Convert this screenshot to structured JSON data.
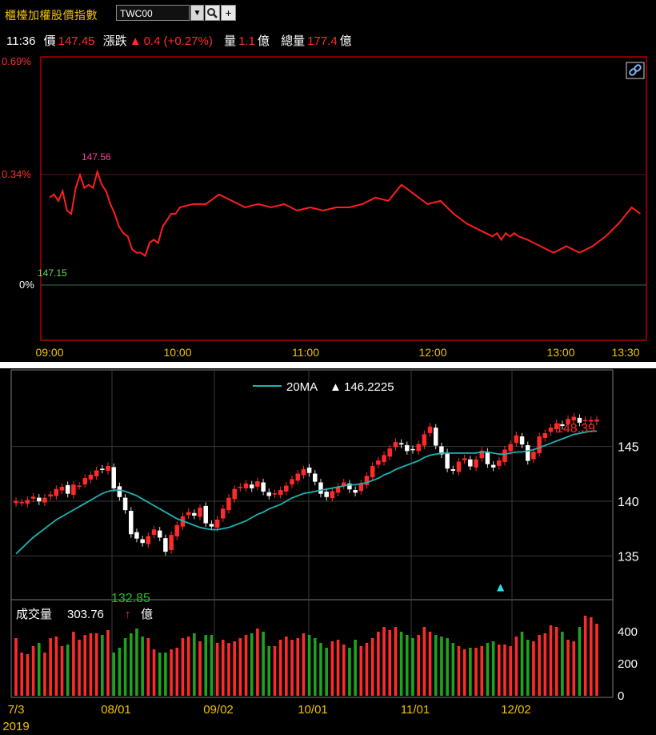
{
  "header": {
    "index_name": "櫃檯加權股價指數",
    "code": "TWC00",
    "dropdown_glyph": "▼",
    "search_icon": "search-icon",
    "add_glyph": "+"
  },
  "quote": {
    "time": "11:36",
    "price_label": "價",
    "price": "147.45",
    "change_label": "漲跌",
    "change_arrow": "▲",
    "change": "0.4 (+0.27%)",
    "vol_label": "量",
    "vol": "1.1",
    "vol_unit": "億",
    "total_label": "總量",
    "total": "177.4",
    "total_unit": "億"
  },
  "colors": {
    "up": "#ff2b2b",
    "down": "#1fa31f",
    "ma": "#20b2b2",
    "label_high": "#ff3ca0",
    "label_low": "#5fdc5f",
    "tick_gold": "#f0c000",
    "border_red": "#b00000"
  },
  "chart_data": [
    {
      "type": "line",
      "name": "intraday",
      "y_tick_labels": [
        "0.69%",
        "0.34%",
        "0%"
      ],
      "ylim_percent": [
        -0.46,
        0.69
      ],
      "x_tick_labels": [
        "09:00",
        "10:00",
        "11:00",
        "12:00",
        "13:00",
        "13:30"
      ],
      "x_range_minutes": [
        0,
        270
      ],
      "high_label": "147.56",
      "ref_label": "147.15",
      "series_minutes": [
        0,
        2,
        4,
        6,
        8,
        10,
        12,
        14,
        16,
        18,
        20,
        22,
        24,
        26,
        28,
        30,
        32,
        34,
        36,
        38,
        40,
        42,
        44,
        46,
        48,
        50,
        52,
        54,
        56,
        58,
        60,
        66,
        72,
        78,
        84,
        90,
        96,
        102,
        108,
        114,
        120,
        126,
        132,
        138,
        144,
        150,
        156,
        162,
        168,
        174,
        180,
        186,
        192,
        198,
        204,
        206,
        208,
        210,
        212,
        214,
        216,
        220,
        226,
        232,
        238,
        244,
        250,
        256,
        262,
        268,
        272
      ],
      "series_percent": [
        0.27,
        0.28,
        0.26,
        0.29,
        0.23,
        0.22,
        0.3,
        0.34,
        0.3,
        0.31,
        0.3,
        0.35,
        0.31,
        0.29,
        0.25,
        0.22,
        0.18,
        0.16,
        0.15,
        0.11,
        0.1,
        0.1,
        0.09,
        0.13,
        0.14,
        0.13,
        0.18,
        0.2,
        0.22,
        0.22,
        0.24,
        0.25,
        0.25,
        0.28,
        0.26,
        0.24,
        0.25,
        0.24,
        0.25,
        0.23,
        0.24,
        0.23,
        0.24,
        0.24,
        0.25,
        0.27,
        0.26,
        0.31,
        0.28,
        0.25,
        0.26,
        0.22,
        0.19,
        0.17,
        0.15,
        0.16,
        0.14,
        0.16,
        0.15,
        0.16,
        0.15,
        0.14,
        0.12,
        0.1,
        0.12,
        0.1,
        0.12,
        0.15,
        0.19,
        0.24,
        0.22
      ]
    },
    {
      "type": "candlestick",
      "name": "daily",
      "legend_label": "20MA",
      "legend_arrow": "▲",
      "legend_value": "146.2225",
      "price_ticks": [
        "145",
        "140",
        "135"
      ],
      "ylim": [
        131,
        152
      ],
      "high_label": "148.39",
      "low_label": "132.85",
      "volume_label": "成交量",
      "volume_value": "303.76",
      "volume_arrow": "↑",
      "volume_unit": "億",
      "volume_ticks": [
        "400",
        "200",
        "0"
      ],
      "volume_ylim": [
        0,
        600
      ],
      "x_tick_labels": [
        "7/3",
        "08/01",
        "09/02",
        "10/01",
        "11/01",
        "12/02"
      ],
      "year_label": "2019",
      "closes": [
        140.0,
        139.9,
        140.1,
        140.4,
        140.0,
        140.3,
        140.6,
        141.1,
        141.3,
        140.7,
        141.5,
        141.4,
        142.1,
        142.4,
        142.8,
        142.9,
        143.2,
        141.2,
        140.4,
        139.2,
        137.0,
        136.6,
        136.2,
        136.8,
        137.4,
        136.7,
        135.4,
        136.9,
        137.8,
        138.6,
        139.0,
        138.7,
        139.4,
        138.0,
        137.7,
        138.3,
        139.3,
        140.3,
        141.1,
        141.3,
        141.6,
        141.2,
        141.8,
        140.9,
        140.5,
        140.7,
        141.0,
        141.4,
        142.0,
        142.5,
        142.9,
        142.6,
        141.8,
        140.7,
        140.4,
        140.9,
        141.3,
        141.7,
        141.1,
        140.8,
        141.6,
        142.3,
        143.2,
        143.7,
        144.2,
        144.8,
        145.4,
        145.2,
        144.6,
        144.7,
        145.2,
        146.1,
        146.8,
        145.1,
        144.3,
        143.0,
        142.8,
        143.6,
        143.9,
        143.2,
        143.8,
        144.6,
        143.4,
        143.1,
        143.7,
        144.7,
        145.2,
        146.0,
        145.2,
        143.7,
        144.5,
        145.9,
        146.2,
        146.7,
        147.1,
        146.9,
        147.5,
        147.7,
        147.2,
        147.4,
        147.4,
        147.45
      ],
      "volumes": [
        360,
        270,
        260,
        310,
        330,
        270,
        360,
        370,
        310,
        320,
        400,
        350,
        380,
        390,
        390,
        380,
        410,
        270,
        300,
        360,
        390,
        420,
        370,
        360,
        290,
        270,
        270,
        290,
        300,
        360,
        370,
        390,
        340,
        380,
        380,
        330,
        350,
        330,
        340,
        360,
        380,
        390,
        420,
        400,
        310,
        310,
        350,
        370,
        350,
        360,
        390,
        380,
        360,
        330,
        300,
        340,
        350,
        320,
        300,
        350,
        310,
        330,
        360,
        400,
        430,
        410,
        430,
        400,
        380,
        360,
        380,
        430,
        400,
        380,
        370,
        360,
        330,
        310,
        290,
        300,
        300,
        310,
        330,
        340,
        320,
        320,
        310,
        370,
        400,
        350,
        340,
        380,
        390,
        440,
        430,
        400,
        350,
        340,
        430,
        500,
        490,
        450,
        420,
        320,
        300,
        300
      ],
      "ma20": [
        135.2,
        135.7,
        136.2,
        136.7,
        137.1,
        137.5,
        137.9,
        138.3,
        138.6,
        138.9,
        139.2,
        139.5,
        139.8,
        140.1,
        140.4,
        140.7,
        140.9,
        141.0,
        141.0,
        140.9,
        140.7,
        140.5,
        140.2,
        139.9,
        139.6,
        139.3,
        139.0,
        138.7,
        138.4,
        138.2,
        138.0,
        137.8,
        137.6,
        137.5,
        137.4,
        137.4,
        137.5,
        137.6,
        137.8,
        138.0,
        138.2,
        138.5,
        138.8,
        139.0,
        139.3,
        139.5,
        139.7,
        140.0,
        140.3,
        140.5,
        140.7,
        140.8,
        140.9,
        141.0,
        141.1,
        141.2,
        141.3,
        141.4,
        141.5,
        141.5,
        141.6,
        141.7,
        141.9,
        142.1,
        142.4,
        142.6,
        142.9,
        143.1,
        143.3,
        143.5,
        143.7,
        144.0,
        144.2,
        144.3,
        144.4,
        144.4,
        144.4,
        144.4,
        144.4,
        144.4,
        144.4,
        144.5,
        144.5,
        144.4,
        144.3,
        144.3,
        144.4,
        144.5,
        144.5,
        144.6,
        144.7,
        144.9,
        145.1,
        145.3,
        145.5,
        145.7,
        145.9,
        146.1,
        146.2,
        146.3,
        146.4,
        146.4
      ]
    }
  ]
}
